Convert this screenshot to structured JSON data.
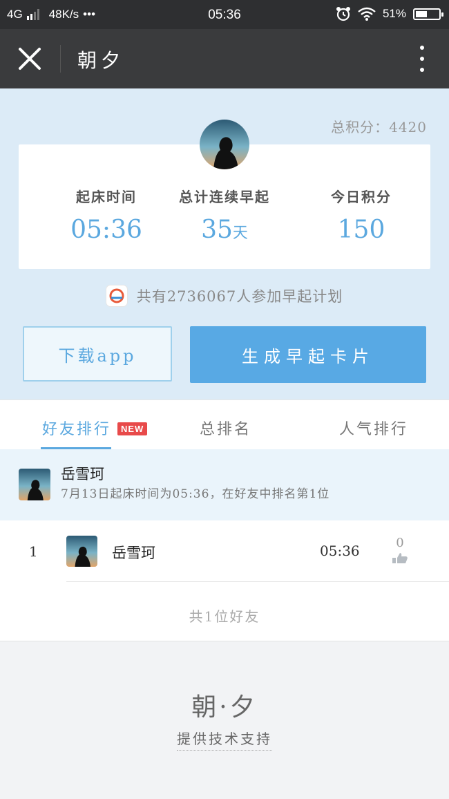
{
  "status_bar": {
    "network": "4G",
    "speed": "48K/s",
    "dots": "•••",
    "time": "05:36",
    "battery": "51%",
    "battery_level": 0.51
  },
  "navbar": {
    "title": "朝夕"
  },
  "hero": {
    "total_score": "总积分：4420",
    "stats": [
      {
        "label": "起床时间",
        "value": "05:36",
        "unit": ""
      },
      {
        "label": "总计连续早起",
        "value": "35",
        "unit": "天"
      },
      {
        "label": "今日积分",
        "value": "150",
        "unit": ""
      }
    ],
    "participants": "共有2736067人参加早起计划",
    "download_button": "下载app",
    "card_button": "生成早起卡片"
  },
  "tabs": {
    "items": [
      "好友排行",
      "总排名",
      "人气排行"
    ],
    "new_badge": "NEW",
    "active": 0
  },
  "my_rank": {
    "name": "岳雪珂",
    "desc": "7月13日起床时间为05:36，在好友中排名第1位"
  },
  "leaderboard": {
    "rows": [
      {
        "rank": "1",
        "name": "岳雪珂",
        "time": "05:36",
        "likes": "0"
      }
    ],
    "count": "共1位好友"
  },
  "footer": {
    "logo": "朝·夕",
    "sub": "提供技术支持"
  },
  "colors": {
    "accent": "#58a9e4",
    "hero_bg": "#dcebf7",
    "new_badge": "#e84a4a"
  }
}
